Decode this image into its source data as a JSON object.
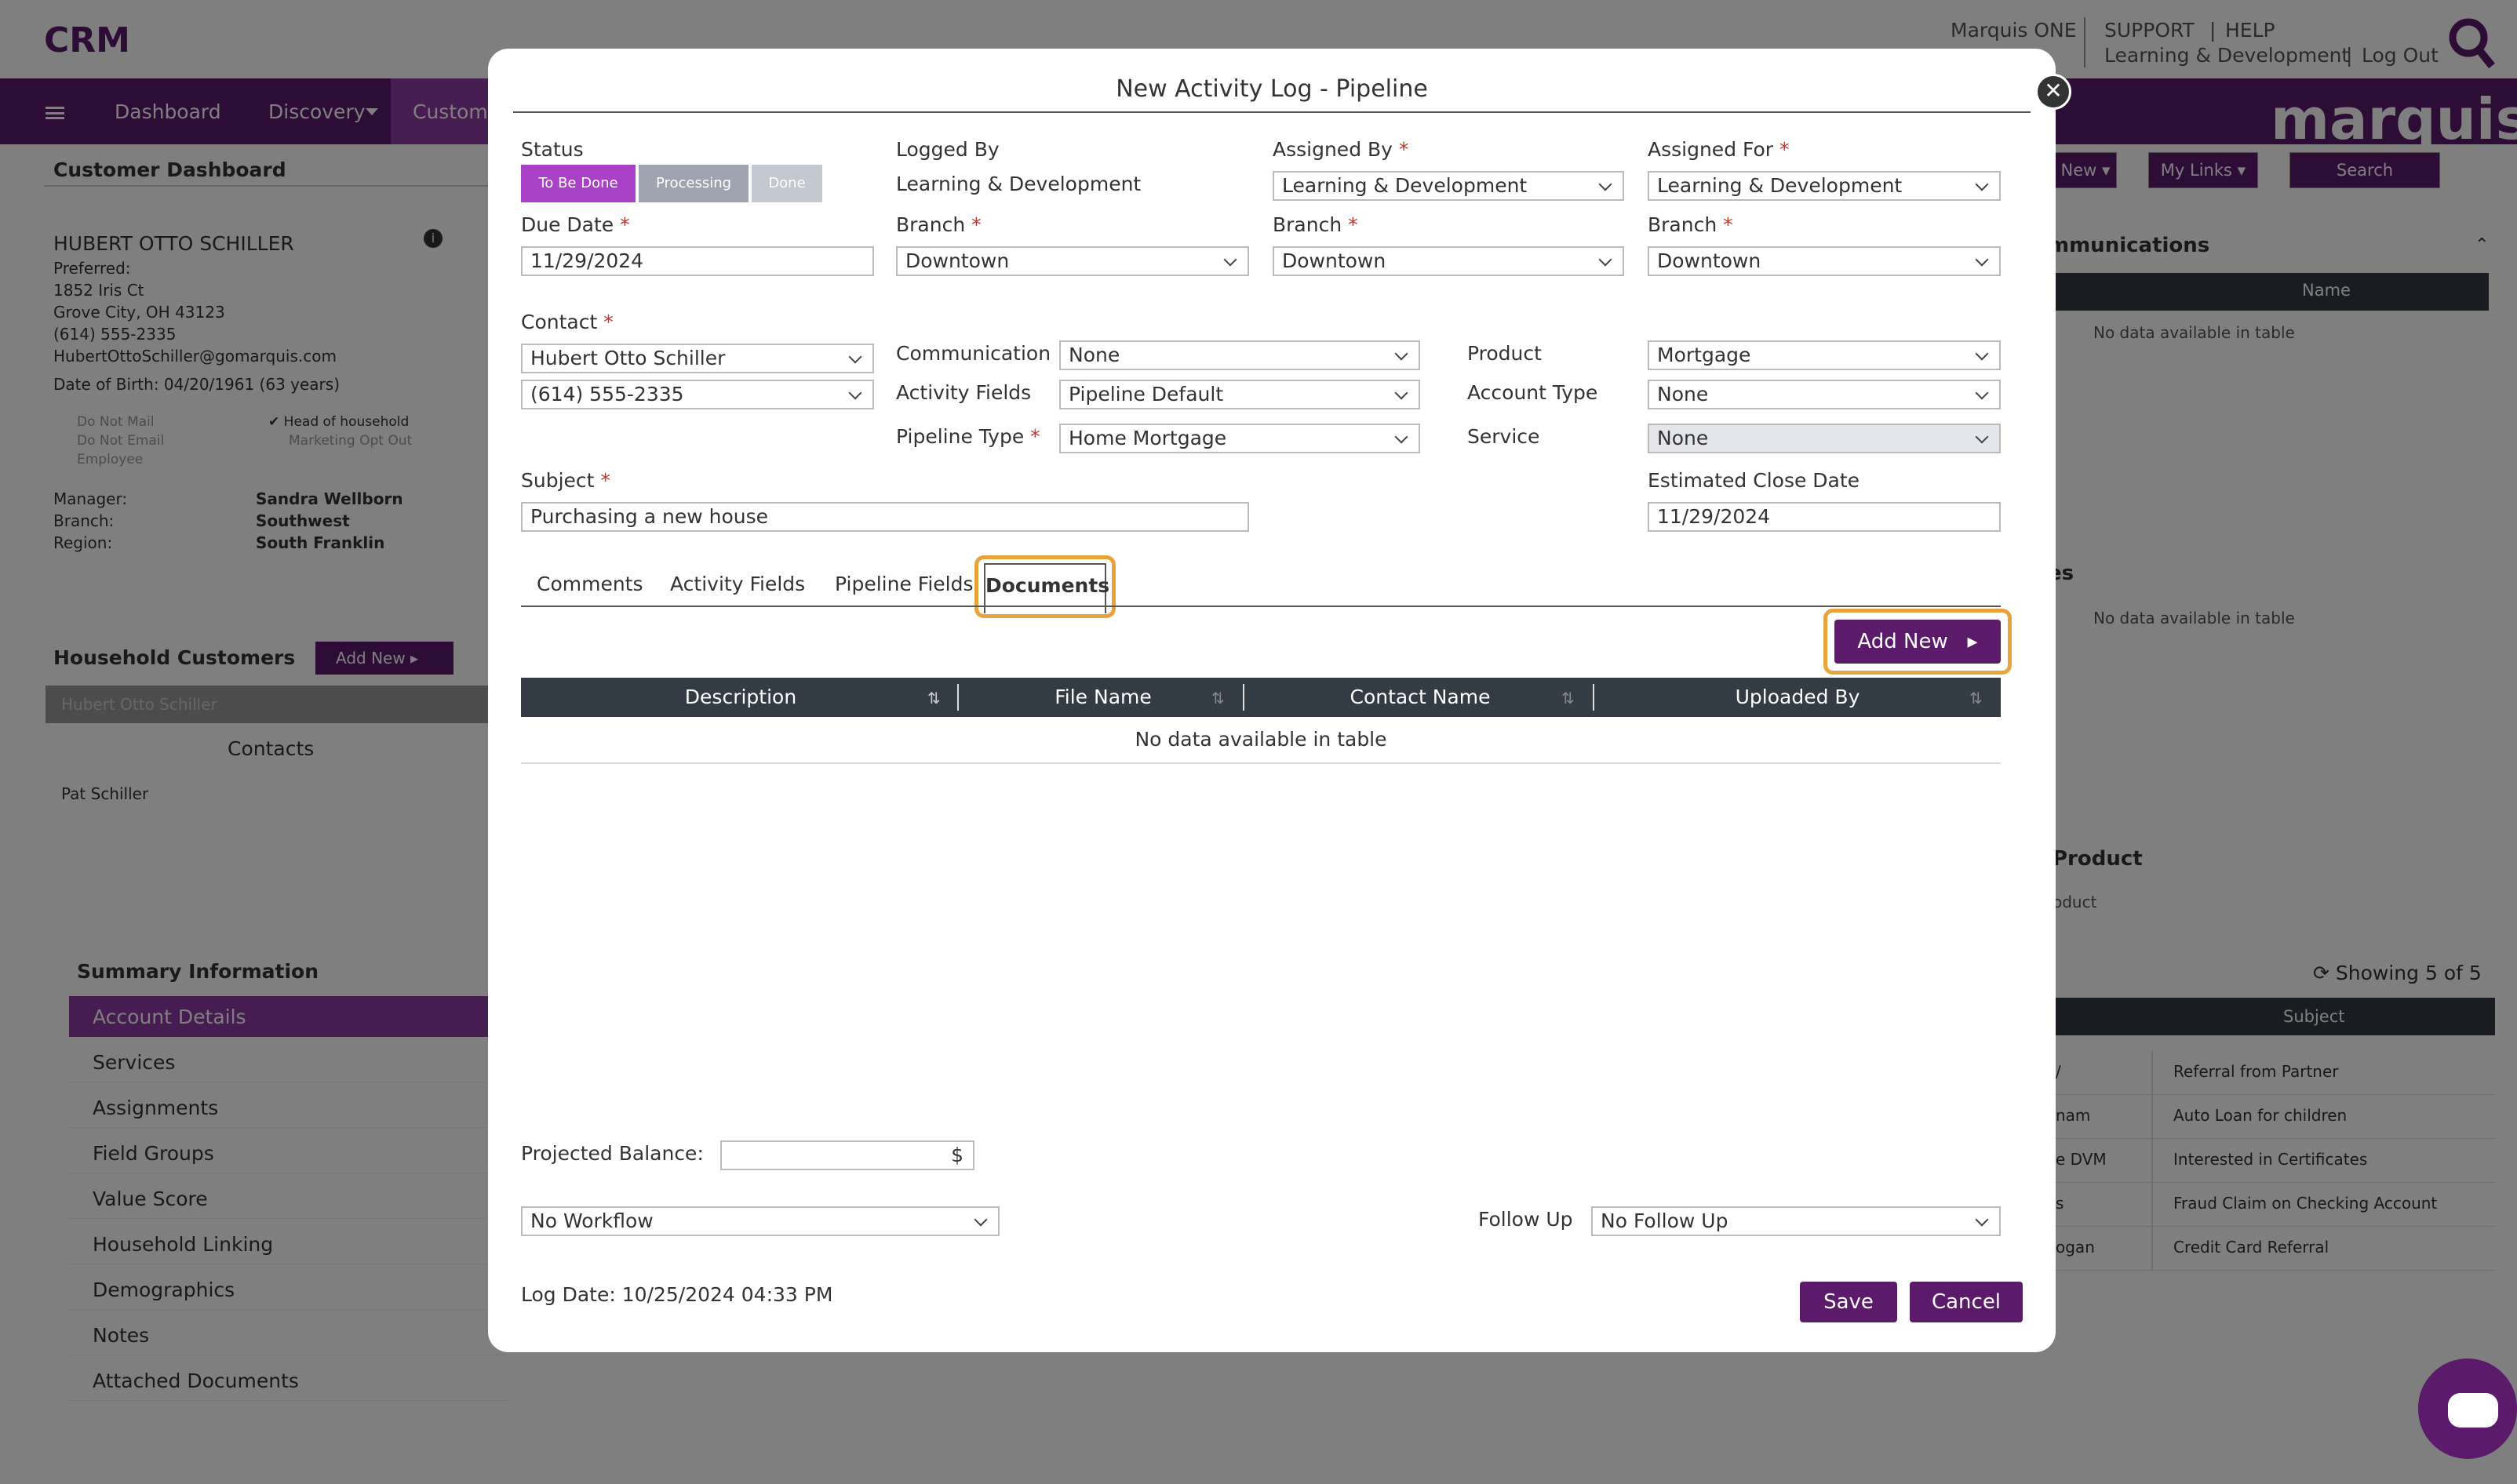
{
  "app": {
    "logo": "CRM",
    "user": "Marquis ONE",
    "support": "SUPPORT",
    "help": "HELP",
    "dept": "Learning & Development",
    "logout": "Log Out",
    "brand": "marquis"
  },
  "nav": {
    "items": [
      "Dashboard",
      "Discovery",
      "Custome"
    ]
  },
  "bgright": {
    "btn_new": "New",
    "btn_mylinks": "My Links",
    "btn_search": "Search",
    "communications": "mmunications",
    "col_name": "Name",
    "no_data": "No data available in table",
    "es": "es",
    "no_data2": "No data available in table",
    "product": "Product",
    "oduct": "oduct",
    "showing": "Showing 5 of 5",
    "col_subject": "Subject",
    "rows": [
      {
        "l": "/",
        "s": "Referral from Partner"
      },
      {
        "l": "nam",
        "s": "Auto Loan for children"
      },
      {
        "l": "e DVM",
        "s": "Interested in Certificates"
      },
      {
        "l": "s",
        "s": "Fraud Claim on Checking Account"
      },
      {
        "l": "ogan",
        "s": "Credit Card Referral"
      }
    ]
  },
  "bgleft": {
    "title": "Customer Dashboard",
    "name": "HUBERT OTTO SCHILLER",
    "preferred": "Preferred:",
    "addr1": "1852 Iris Ct",
    "addr2": "Grove City, OH 43123",
    "phone": "(614) 555-2335",
    "email": "HubertOttoSchiller@gomarquis.com",
    "dob": "Date of Birth: 04/20/1961 (63 years)",
    "flags": {
      "do_not_mail": "Do Not Mail",
      "do_not_email": "Do Not Email",
      "employee": "Employee",
      "head": "Head of household",
      "mkt": "Marketing Opt Out"
    },
    "manager_l": "Manager:",
    "manager_v": "Sandra Wellborn",
    "branch_l": "Branch:",
    "branch_v": "Southwest",
    "region_l": "Region:",
    "region_v": "South Franklin",
    "household": "Household Customers",
    "add_new": "Add New",
    "hh_member": "Hubert Otto Schiller",
    "contacts": "Contacts",
    "contact1": "Pat Schiller",
    "summary": "Summary Information",
    "summary_items": [
      "Account Details",
      "Services",
      "Assignments",
      "Field Groups",
      "Value Score",
      "Household Linking",
      "Demographics",
      "Notes",
      "Attached Documents"
    ]
  },
  "modal": {
    "title": "New Activity Log - Pipeline",
    "status_label": "Status",
    "status": [
      "To Be Done",
      "Processing",
      "Done"
    ],
    "logged_by_label": "Logged By",
    "logged_by": "Learning & Development",
    "assigned_by_label": "Assigned By",
    "assigned_by": "Learning & Development",
    "assigned_for_label": "Assigned For",
    "assigned_for": "Learning & Development",
    "due_date_label": "Due Date",
    "due_date": "11/29/2024",
    "branch_label": "Branch",
    "branch1": "Downtown",
    "branch2": "Downtown",
    "branch3": "Downtown",
    "contact_label": "Contact",
    "contact": "Hubert Otto Schiller",
    "contact_phone": "(614) 555-2335",
    "communication_label": "Communication",
    "communication": "None",
    "activity_fields_label": "Activity Fields",
    "activity_fields": "Pipeline Default",
    "pipeline_type_label": "Pipeline Type",
    "pipeline_type": "Home Mortgage",
    "product_label": "Product",
    "product": "Mortgage",
    "account_type_label": "Account Type",
    "account_type": "None",
    "service_label": "Service",
    "service": "None",
    "subject_label": "Subject",
    "subject": "Purchasing a new house",
    "est_close_label": "Estimated Close Date",
    "est_close": "11/29/2024",
    "tabs": [
      "Comments",
      "Activity Fields",
      "Pipeline Fields",
      "Documents"
    ],
    "add_new": "Add New",
    "columns": [
      "Description",
      "File Name",
      "Contact Name",
      "Uploaded By"
    ],
    "empty": "No data available in table",
    "projected_label": "Projected Balance:",
    "currency": "$",
    "workflow": "No Workflow",
    "follow_up_label": "Follow Up",
    "follow_up": "No Follow Up",
    "log_date": "Log Date: 10/25/2024 04:33 PM",
    "save": "Save",
    "cancel": "Cancel"
  },
  "colors": {
    "purple": "#5b1a6a",
    "status_active": "#a942c7",
    "highlight": "#e8a33a"
  }
}
